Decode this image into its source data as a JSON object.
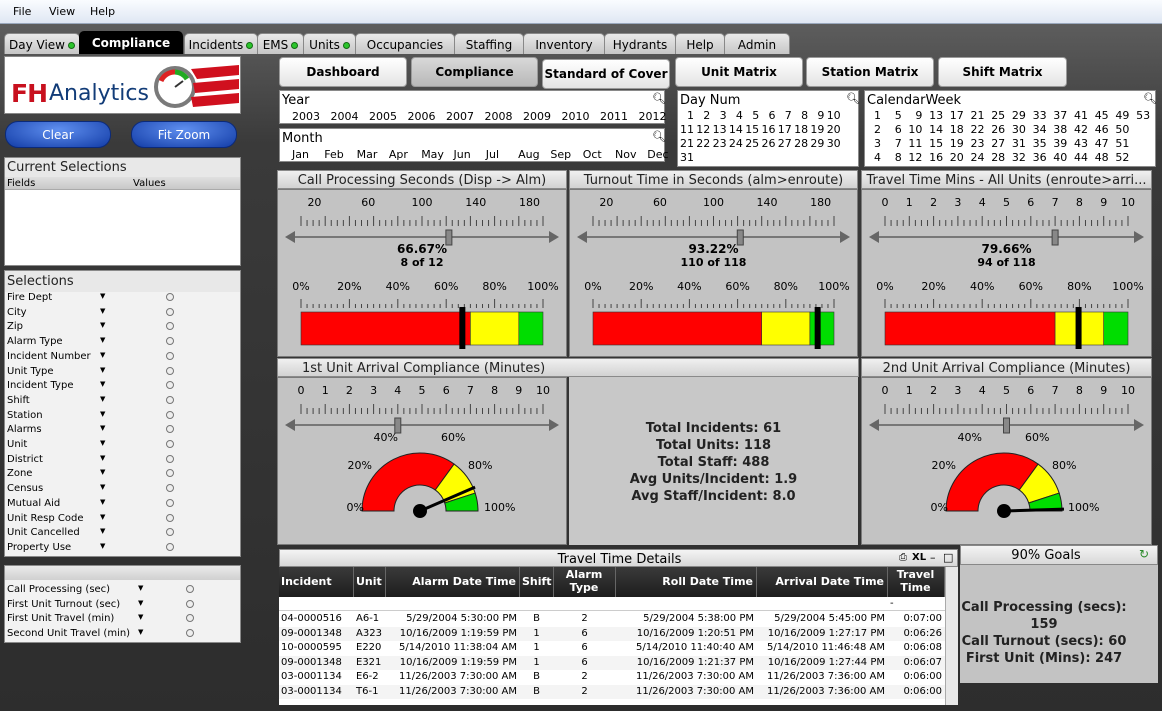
{
  "menu": [
    "File",
    "View",
    "Help"
  ],
  "tabs": [
    {
      "label": "Day View",
      "dot": true
    },
    {
      "label": "Compliance",
      "dot": false,
      "active": true
    },
    {
      "label": "Incidents",
      "dot": true
    },
    {
      "label": "EMS",
      "dot": true
    },
    {
      "label": "Units",
      "dot": true
    },
    {
      "label": "Occupancies",
      "dot": false
    },
    {
      "label": "Staffing",
      "dot": false
    },
    {
      "label": "Inventory",
      "dot": false
    },
    {
      "label": "Hydrants",
      "dot": false
    },
    {
      "label": "Help",
      "dot": false
    },
    {
      "label": "Admin",
      "dot": false
    }
  ],
  "logo": {
    "text_a": "FH",
    "text_b": "Analytics"
  },
  "buttons": {
    "clear": "Clear",
    "fit_zoom": "Fit Zoom"
  },
  "current_selections": {
    "title": "Current Selections",
    "col_fields": "Fields",
    "col_values": "Values"
  },
  "selections": {
    "title": "Selections",
    "items": [
      "Fire Dept",
      "City",
      "Zip",
      "Alarm Type",
      "Incident Number",
      "Unit Type",
      "Incident Type",
      "Shift",
      "Station",
      "Alarms",
      "Unit",
      "District",
      "Zone",
      "Census",
      "Mutual Aid",
      "Unit Resp Code",
      "Unit Cancelled",
      "Property Use"
    ]
  },
  "metric_selectors": [
    "Call Processing (sec)",
    "First Unit Turnout (sec)",
    "First Unit Travel (min)",
    "Second Unit Travel (min)"
  ],
  "nav_buttons": [
    "Dashboard",
    "Compliance",
    "Standard of Cover",
    "Unit Matrix",
    "Station Matrix",
    "Shift Matrix"
  ],
  "year": {
    "title": "Year",
    "values": [
      "2003",
      "2004",
      "2005",
      "2006",
      "2007",
      "2008",
      "2009",
      "2010",
      "2011",
      "2012"
    ]
  },
  "month": {
    "title": "Month",
    "values": [
      "Jan",
      "Feb",
      "Mar",
      "Apr",
      "May",
      "Jun",
      "Jul",
      "Aug",
      "Sep",
      "Oct",
      "Nov",
      "Dec"
    ]
  },
  "day_num": {
    "title": "Day Num",
    "rows": [
      [
        "1",
        "2",
        "3",
        "4",
        "5",
        "6",
        "7",
        "8",
        "9",
        "10"
      ],
      [
        "11",
        "12",
        "13",
        "14",
        "15",
        "16",
        "17",
        "18",
        "19",
        "20"
      ],
      [
        "21",
        "22",
        "23",
        "24",
        "25",
        "26",
        "27",
        "28",
        "29",
        "30"
      ],
      [
        "31"
      ]
    ]
  },
  "calendar_week": {
    "title": "CalendarWeek",
    "rows": [
      [
        "1",
        "5",
        "9",
        "13",
        "17",
        "21",
        "25",
        "29",
        "33",
        "37",
        "41",
        "45",
        "49",
        "53"
      ],
      [
        "2",
        "6",
        "10",
        "14",
        "18",
        "22",
        "26",
        "30",
        "34",
        "38",
        "42",
        "46",
        "50"
      ],
      [
        "3",
        "7",
        "11",
        "15",
        "19",
        "23",
        "27",
        "31",
        "35",
        "39",
        "43",
        "47",
        "51"
      ],
      [
        "4",
        "8",
        "12",
        "16",
        "20",
        "24",
        "28",
        "32",
        "36",
        "40",
        "44",
        "48",
        "52"
      ]
    ]
  },
  "linear_gauges": [
    {
      "title": "Call Processing Seconds (Disp -> Alm)",
      "slider_ticks": [
        "20",
        "60",
        "100",
        "140",
        "180"
      ],
      "slider_min": 10,
      "slider_max": 190,
      "slider_value": 120,
      "pct": "66.67%",
      "count": "8 of 12",
      "value": 0.6667,
      "bands": [
        0.7,
        0.9,
        1.0
      ]
    },
    {
      "title": "Turnout Time in Seconds (alm>enroute)",
      "slider_ticks": [
        "20",
        "60",
        "100",
        "140",
        "180"
      ],
      "slider_min": 10,
      "slider_max": 190,
      "slider_value": 120,
      "pct": "93.22%",
      "count": "110 of 118",
      "value": 0.9322,
      "bands": [
        0.7,
        0.9,
        1.0
      ]
    },
    {
      "title": "Travel Time Mins - All Units (enroute>arri...",
      "slider_ticks": [
        "0",
        "1",
        "2",
        "3",
        "4",
        "5",
        "6",
        "7",
        "8",
        "9",
        "10"
      ],
      "slider_min": 0,
      "slider_max": 10,
      "slider_value": 7,
      "pct": "79.66%",
      "count": "94 of 118",
      "value": 0.7966,
      "bands": [
        0.7,
        0.9,
        1.0
      ]
    }
  ],
  "bar_ticks": [
    "0%",
    "20%",
    "40%",
    "60%",
    "80%",
    "100%"
  ],
  "dial_gauges": [
    {
      "title": "1st Unit Arrival Compliance (Minutes)",
      "slider_ticks": [
        "0",
        "1",
        "2",
        "3",
        "4",
        "5",
        "6",
        "7",
        "8",
        "9",
        "10"
      ],
      "slider_min": 0,
      "slider_max": 10,
      "slider_value": 4,
      "value": 0.87
    },
    {
      "title": "2nd Unit Arrival Compliance (Minutes)",
      "slider_ticks": [
        "0",
        "1",
        "2",
        "3",
        "4",
        "5",
        "6",
        "7",
        "8",
        "9",
        "10"
      ],
      "slider_min": 0,
      "slider_max": 10,
      "slider_value": 5,
      "value": 0.99
    }
  ],
  "dial_ticks": [
    "0%",
    "20%",
    "40%",
    "60%",
    "80%",
    "100%"
  ],
  "totals": [
    "Total Incidents: 61",
    "Total Units: 118",
    "Total Staff: 488",
    "Avg Units/Incident: 1.9",
    "Avg Staff/Incident: 8.0"
  ],
  "travel_table": {
    "title": "Travel Time Details",
    "header_icons": "XL",
    "columns": [
      "Incident",
      "Unit",
      "Alarm Date Time",
      "Shift",
      "Alarm Type",
      "Roll Date Time",
      "Arrival Date Time",
      "Travel Time"
    ],
    "sort_marker": "-",
    "rows": [
      [
        "04-0000516",
        "A6-1",
        "5/29/2004 5:30:00 PM",
        "B",
        "2",
        "5/29/2004 5:38:00 PM",
        "5/29/2004 5:45:00 PM",
        "0:07:00"
      ],
      [
        "09-0001348",
        "A323",
        "10/16/2009 1:19:59 PM",
        "1",
        "6",
        "10/16/2009 1:20:51 PM",
        "10/16/2009 1:27:17 PM",
        "0:06:26"
      ],
      [
        "10-0000595",
        "E220",
        "5/14/2010 11:38:04 AM",
        "1",
        "6",
        "5/14/2010 11:40:40 AM",
        "5/14/2010 11:46:48 AM",
        "0:06:08"
      ],
      [
        "09-0001348",
        "E321",
        "10/16/2009 1:19:59 PM",
        "1",
        "6",
        "10/16/2009 1:21:37 PM",
        "10/16/2009 1:27:44 PM",
        "0:06:07"
      ],
      [
        "03-0001134",
        "E6-2",
        "11/26/2003 7:30:00 AM",
        "B",
        "2",
        "11/26/2003 7:30:00 AM",
        "11/26/2003 7:36:00 AM",
        "0:06:00"
      ],
      [
        "03-0001134",
        "T6-1",
        "11/26/2003 7:30:00 AM",
        "B",
        "2",
        "11/26/2003 7:30:00 AM",
        "11/26/2003 7:36:00 AM",
        "0:06:00"
      ]
    ]
  },
  "goals": {
    "title": "90% Goals",
    "lines": [
      "Call Processing (secs): 159",
      "Call Turnout (secs): 60",
      "First Unit (Mins): 247"
    ]
  },
  "colors": {
    "red": "#ff0000",
    "yellow": "#ffff00",
    "green": "#00dd00",
    "active_tab": "#000000"
  }
}
